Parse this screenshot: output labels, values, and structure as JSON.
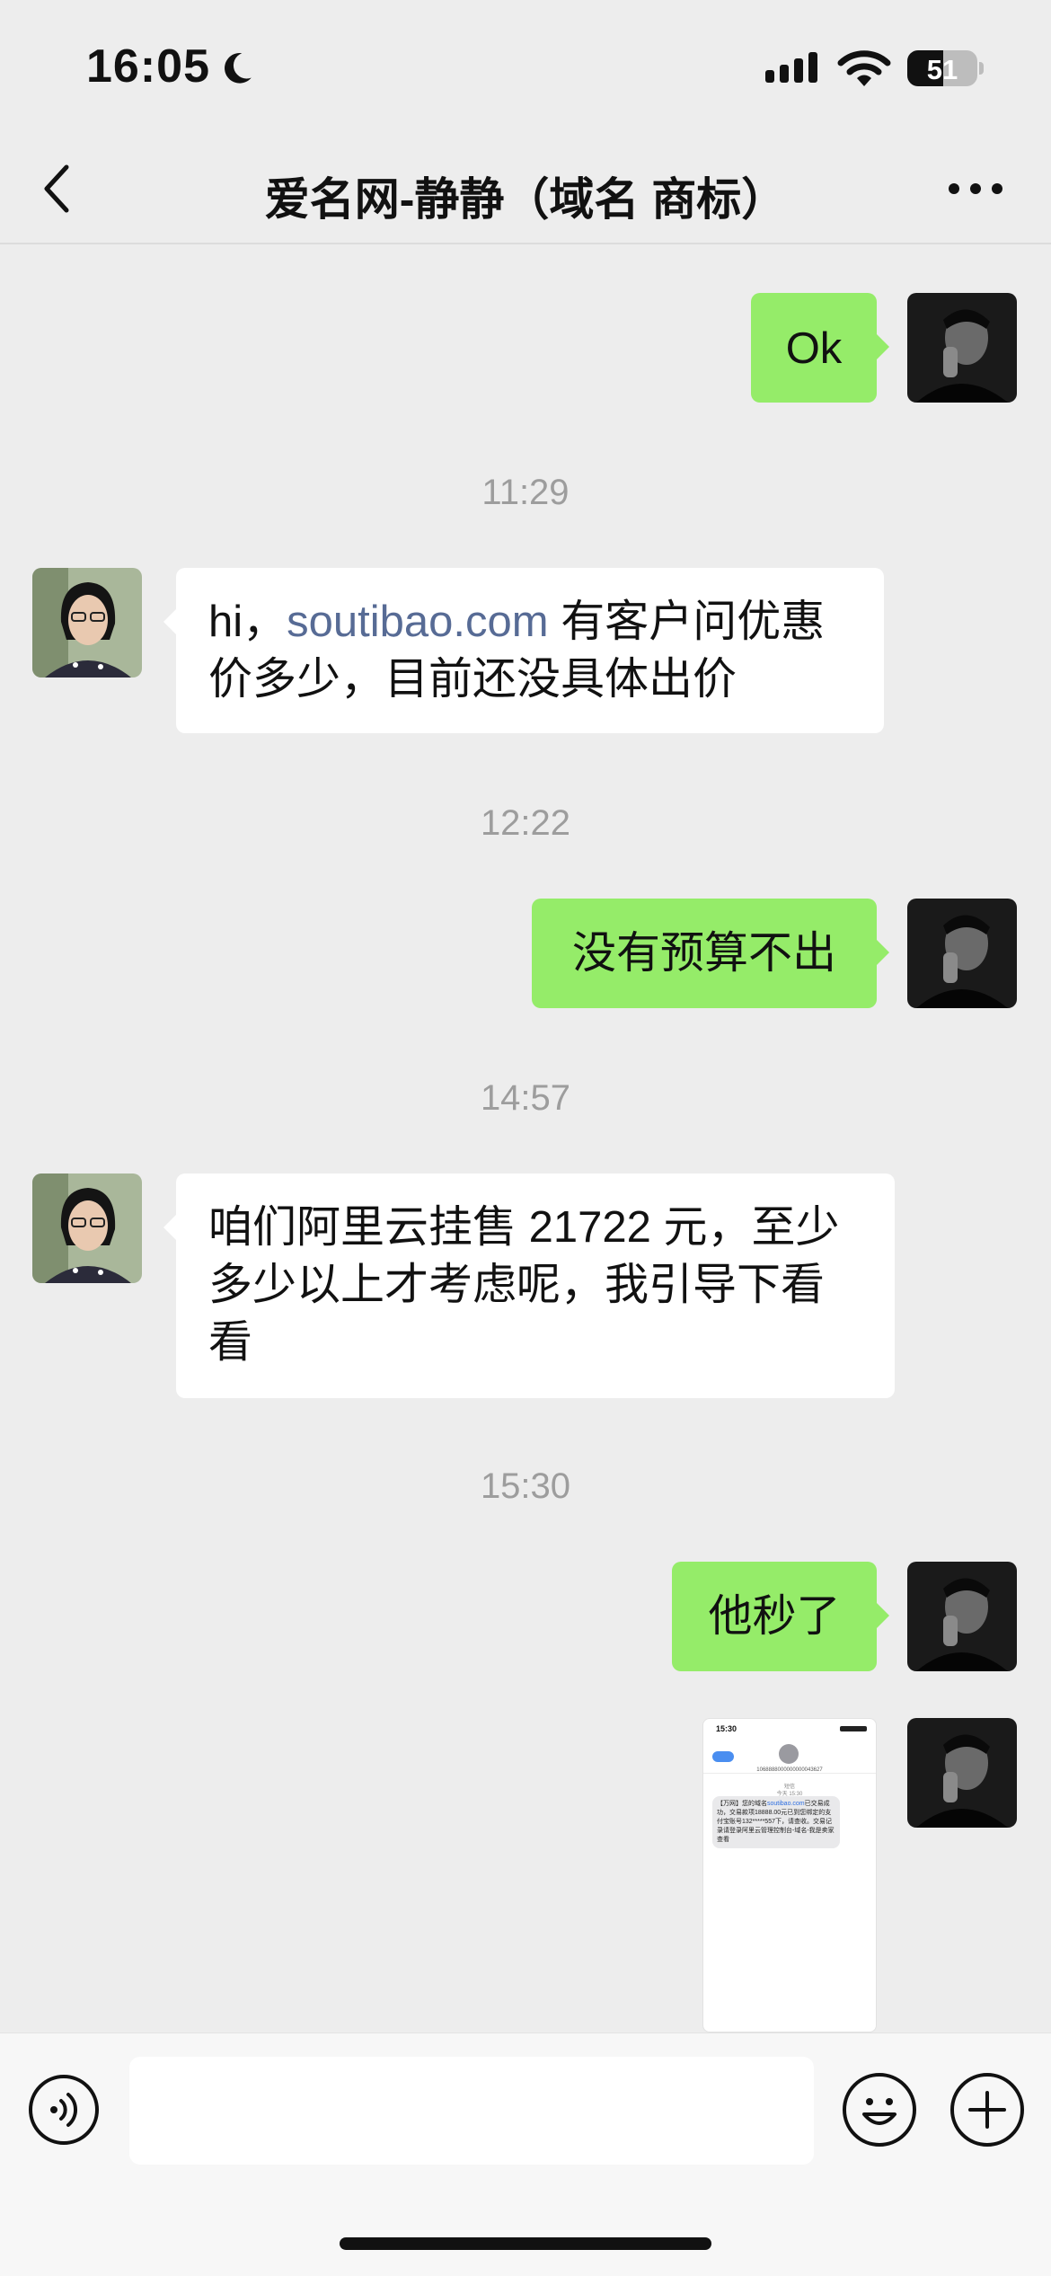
{
  "status_bar": {
    "time": "16:05",
    "battery": "51",
    "battery_level": 0.51
  },
  "header": {
    "title": "爱名网-静静（域名 商标）"
  },
  "messages": [
    {
      "type": "text",
      "sender": "me",
      "text": "Ok"
    },
    {
      "type": "time",
      "text": "11:29"
    },
    {
      "type": "text",
      "sender": "them",
      "prefix": "hi，",
      "link": "soutibao.com",
      "suffix": " 有客户问优惠价多少，目前还没具体出价"
    },
    {
      "type": "time",
      "text": "12:22"
    },
    {
      "type": "text",
      "sender": "me",
      "text": "没有预算不出"
    },
    {
      "type": "time",
      "text": "14:57"
    },
    {
      "type": "text",
      "sender": "them",
      "text": "咱们阿里云挂售 21722 元，至少多少以上才考虑呢，我引导下看看"
    },
    {
      "type": "time",
      "text": "15:30"
    },
    {
      "type": "text",
      "sender": "me",
      "text": "他秒了"
    },
    {
      "type": "image",
      "sender": "me",
      "screenshot": {
        "time": "15:30",
        "number": "1068888000000000043627",
        "label": "短信",
        "date": "今天 15:30",
        "sms_prefix": "【万网】您的域名",
        "sms_link": "soutibao.com",
        "sms_body": "已交易成功，交易款项18888.00元已到您绑定的支付宝账号132*****557下，请查收。交易记录请登录阿里云管理控制台-域名-我是卖家查看"
      }
    }
  ],
  "input_bar": {
    "voice_icon": "voice-icon",
    "emoji_icon": "emoji-icon",
    "plus_icon": "plus-icon"
  },
  "colors": {
    "background": "#ededed",
    "my_bubble": "#95ec69",
    "their_bubble": "#ffffff",
    "link": "#576b95",
    "timestamp": "#9d9d9d"
  }
}
